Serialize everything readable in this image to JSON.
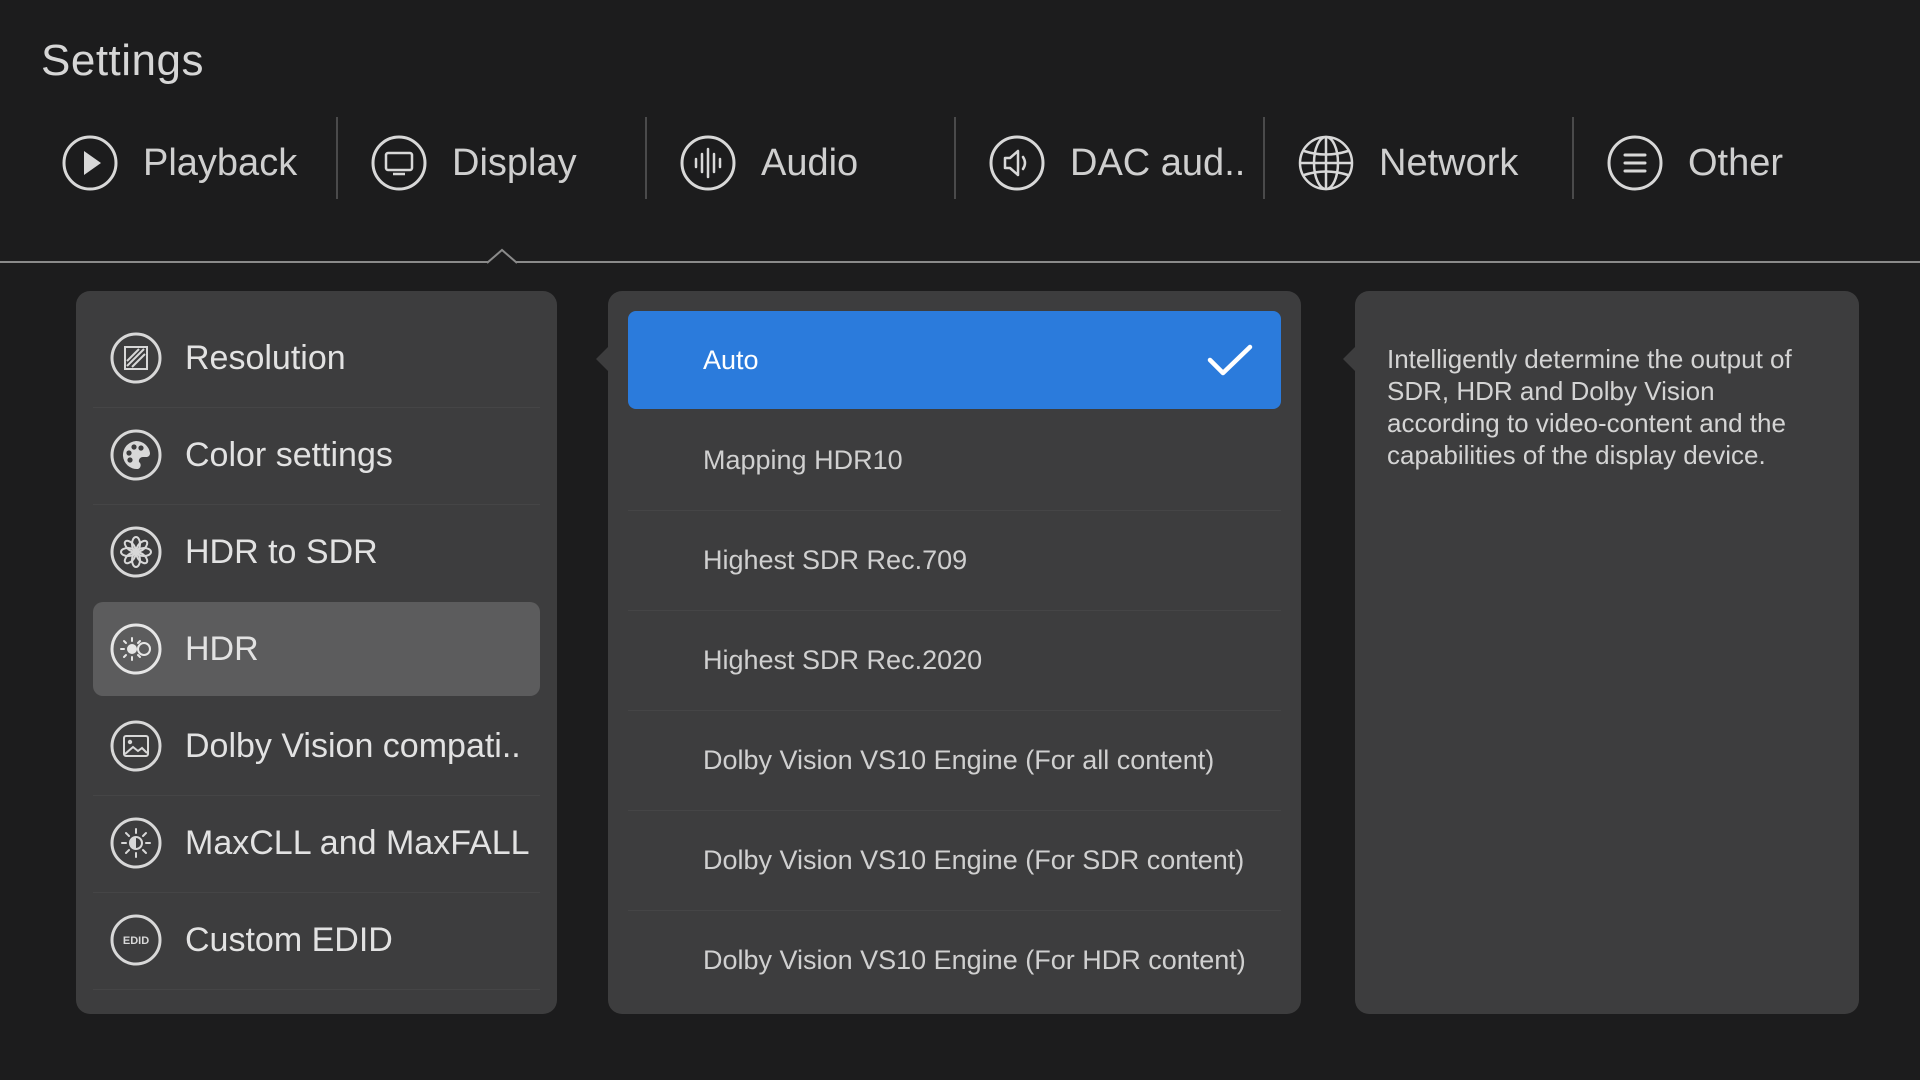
{
  "header": {
    "title": "Settings"
  },
  "tabs": [
    {
      "label": "Playback",
      "icon": "play-icon"
    },
    {
      "label": "Display",
      "icon": "monitor-icon"
    },
    {
      "label": "Audio",
      "icon": "audio-waveform-icon"
    },
    {
      "label": "DAC aud..",
      "icon": "speaker-icon"
    },
    {
      "label": "Network",
      "icon": "globe-icon"
    },
    {
      "label": "Other",
      "icon": "menu-lines-icon"
    }
  ],
  "active_tab": "Display",
  "menu": {
    "items": [
      {
        "label": "Resolution",
        "icon": "resolution-icon"
      },
      {
        "label": "Color settings",
        "icon": "palette-icon"
      },
      {
        "label": "HDR to SDR",
        "icon": "aperture-icon"
      },
      {
        "label": "HDR",
        "icon": "hdr-sun-icon"
      },
      {
        "label": "Dolby Vision compati..",
        "icon": "picture-icon"
      },
      {
        "label": "MaxCLL and MaxFALL",
        "icon": "brightness-icon"
      },
      {
        "label": "Custom EDID",
        "icon": "edid-icon"
      }
    ],
    "active": "HDR",
    "edid_badge": "EDID"
  },
  "options": {
    "items": [
      {
        "label": "Auto"
      },
      {
        "label": "Mapping HDR10"
      },
      {
        "label": "Highest SDR Rec.709"
      },
      {
        "label": "Highest SDR Rec.2020"
      },
      {
        "label": "Dolby Vision VS10 Engine (For all content)"
      },
      {
        "label": "Dolby Vision VS10 Engine (For SDR content)"
      },
      {
        "label": "Dolby Vision VS10 Engine (For HDR content)"
      }
    ],
    "selected": "Auto"
  },
  "description": {
    "text": "Intelligently determine the output of SDR, HDR and Dolby Vision according to video-content and the capabilities of the display device."
  },
  "colors": {
    "background": "#1c1c1d",
    "panel": "#3d3d3e",
    "active_item": "#5c5c5d",
    "accent": "#2b7bdc"
  }
}
